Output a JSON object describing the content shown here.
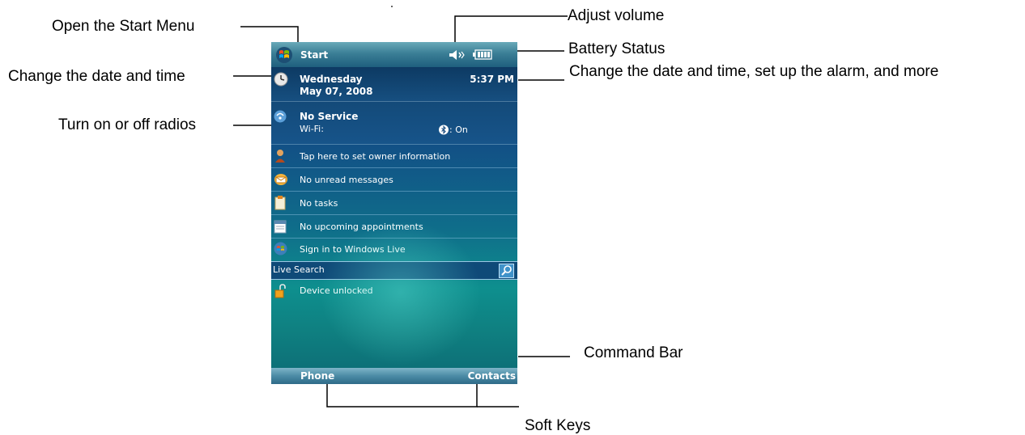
{
  "callouts": {
    "start_menu": "Open the Start Menu",
    "date_time": "Change the date and time",
    "radios": "Turn on or off radios",
    "adjust_volume": "Adjust volume",
    "battery": "Battery Status",
    "date_time_alarm": "Change the date and time, set up the alarm, and more",
    "command_bar": "Command Bar",
    "soft_keys": "Soft Keys"
  },
  "device": {
    "title_bar": {
      "start_label": "Start"
    },
    "date": {
      "day": "Wednesday",
      "date": "May 07, 2008",
      "time": "5:37 PM"
    },
    "connectivity": {
      "status": "No Service",
      "wifi_label": "Wi-Fi:",
      "bt_label": ": On"
    },
    "items": [
      {
        "label": "Tap here to set owner information",
        "icon": "owner-icon"
      },
      {
        "label": "No unread messages",
        "icon": "messages-icon"
      },
      {
        "label": "No tasks",
        "icon": "tasks-icon"
      },
      {
        "label": "No upcoming appointments",
        "icon": "calendar-icon"
      },
      {
        "label": "Sign in to Windows Live",
        "icon": "windows-live-icon"
      }
    ],
    "search": {
      "label": "Live Search"
    },
    "lock": {
      "label": "Device unlocked"
    },
    "softkeys": {
      "left": "Phone",
      "right": "Contacts"
    }
  },
  "colors": {
    "accent": "#0f4a78",
    "title_bar": "#3b7f96"
  }
}
